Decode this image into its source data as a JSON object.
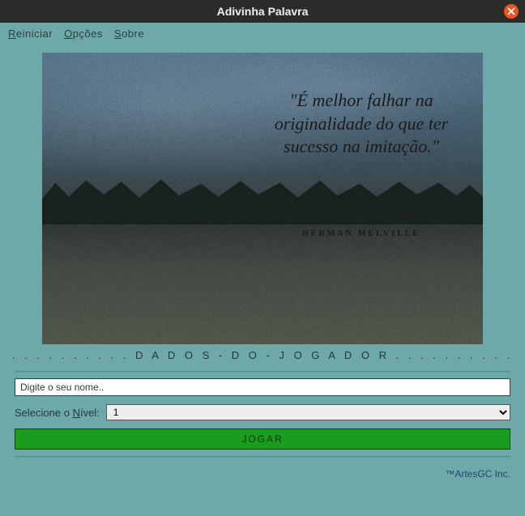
{
  "window": {
    "title": "Adivinha Palavra"
  },
  "menu": {
    "reiniciar": "Reiniciar",
    "opcoes": "Opções",
    "sobre": "Sobre"
  },
  "hero": {
    "quote": "\"É melhor falhar na originalidade do que ter sucesso na imitação.\"",
    "author": "HERMAN MELVILLE"
  },
  "section_title": ". . . . . . . . . . D A D O S - D O - J O G A D O R . . . . . . . . . .",
  "form": {
    "name_placeholder": "Digite o seu nome..",
    "level_label_pre": "Selecione o ",
    "level_label_ul": "N",
    "level_label_post": "ível:",
    "level_value": "1",
    "play_label": "JOGAR"
  },
  "footer": {
    "brand": "™ArtesGC Inc."
  }
}
